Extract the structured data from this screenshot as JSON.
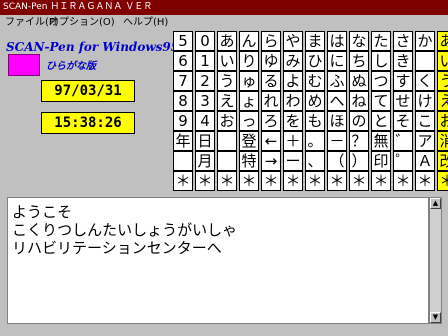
{
  "window": {
    "title": "SCAN-Pen ＨＩＲＡＧＡＮＡ ＶＥＲ"
  },
  "menu": [
    {
      "label": "ファイル(F)"
    },
    {
      "label": "オプション(O)"
    },
    {
      "label": "ヘルプ(H)"
    }
  ],
  "app": {
    "name": "SCAN-Pen for Windows95",
    "edition": "ひらがな版"
  },
  "date": "97/03/31",
  "time": "15:38:26",
  "keyboard": {
    "rows": [
      [
        "5",
        "0",
        "あ",
        "ん",
        "ら",
        "や",
        "ま",
        "は",
        "な",
        "た",
        "さ",
        "か",
        "あ"
      ],
      [
        "6",
        "1",
        "い",
        "り",
        "ゆ",
        "み",
        "ひ",
        "に",
        "ち",
        "し",
        "き",
        "い"
      ],
      [
        "7",
        "2",
        "う",
        "ゅ",
        "る",
        "よ",
        "む",
        "ふ",
        "ぬ",
        "つ",
        "す",
        "く",
        "う"
      ],
      [
        "8",
        "3",
        "え",
        "ょ",
        "れ",
        "わ",
        "め",
        "へ",
        "ね",
        "て",
        "せ",
        "け",
        "え"
      ],
      [
        "9",
        "4",
        "お",
        "っ",
        "ろ",
        "を",
        "も",
        "ほ",
        "の",
        "と",
        "そ",
        "こ",
        "お"
      ],
      [
        "年",
        "日",
        "　",
        "登",
        "←",
        "＋",
        "。",
        "－",
        "？",
        "無",
        "゛",
        "ア",
        "消"
      ],
      [
        "　",
        "月",
        "　",
        "特",
        "→",
        "ー",
        "、",
        "（",
        "）",
        "印",
        "゜",
        "Ａ",
        "改"
      ],
      [
        "＊",
        "＊",
        "＊",
        "＊",
        "＊",
        "＊",
        "＊",
        "＊",
        "＊",
        "＊",
        "＊",
        "＊",
        "＊"
      ]
    ]
  },
  "text": {
    "lines": [
      "ようこそ",
      "こくりつしんたいしょうがいしゃ",
      "リハビリテーションセンターへ"
    ]
  },
  "colors": {
    "titlebar": "#800000",
    "highlight": "#ffff00",
    "logo": "#ff00ff",
    "brand": "#0000cc"
  }
}
